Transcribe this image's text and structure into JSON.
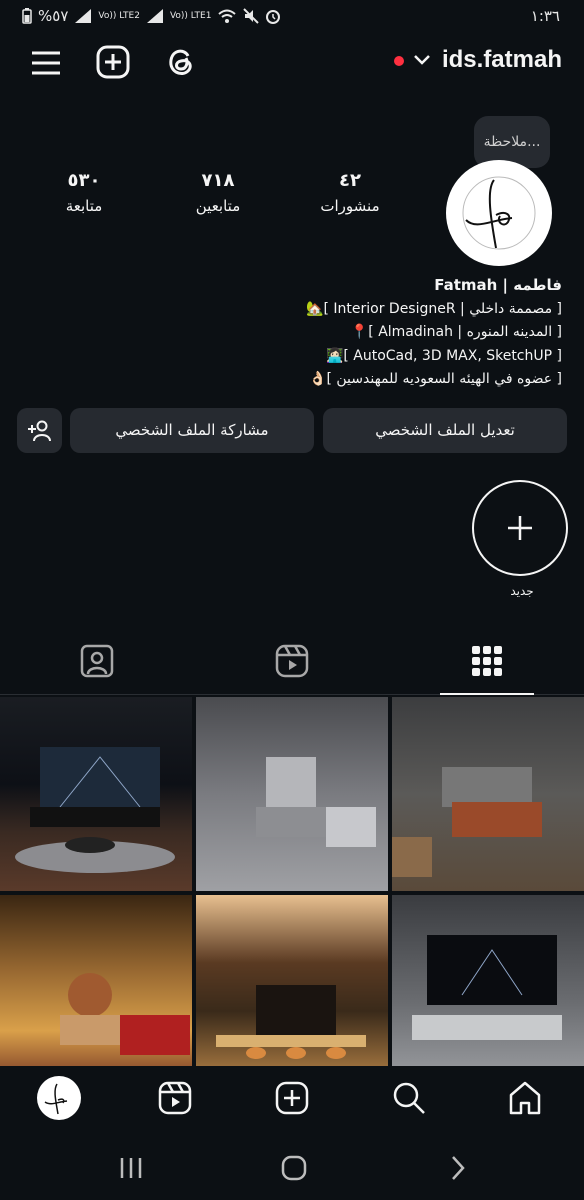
{
  "status_bar": {
    "battery": "%٥٧",
    "sim1": "Vo)) LTE2",
    "sim2": "Vo)) LTE1",
    "time": "١:٣٦"
  },
  "header": {
    "username": "ids.fatmah",
    "icons": [
      "menu-icon",
      "create-icon",
      "threads-icon",
      "chevron-down-icon"
    ]
  },
  "note": {
    "placeholder": "ملاحظة..."
  },
  "stats": {
    "posts_count": "٤٢",
    "posts_label": "منشورات",
    "followers_count": "٧١٨",
    "followers_label": "متابعين",
    "following_count": "٥٣٠",
    "following_label": "متابعة"
  },
  "bio": {
    "name": "فاطمه | Fatmah",
    "line1": "[ مصممة داخلي | Interior DesigneR ]🏡",
    "line2": "[ المدينه المنوره | Almadinah ]📍",
    "line3": "[ AutoCad, 3D MAX, SketchUP ]👩🏻‍💻",
    "line4": "[ عضوه في الهيئه السعوديه للمهندسين ]👌🏻"
  },
  "buttons": {
    "edit_profile": "تعديل الملف الشخصي",
    "share_profile": "مشاركة الملف الشخصي"
  },
  "highlight": {
    "new_label": "جديد"
  },
  "tabs": [
    "grid-icon",
    "reels-icon",
    "tagged-icon"
  ],
  "grid_tiles": [
    "living-room-dark",
    "kitchen-grey",
    "kitchen-copper",
    "living-room-warm",
    "loft-kitchen",
    "living-room-tv"
  ],
  "bottom_nav": [
    "home-icon",
    "search-icon",
    "create-icon",
    "reels-icon",
    "profile-avatar"
  ]
}
